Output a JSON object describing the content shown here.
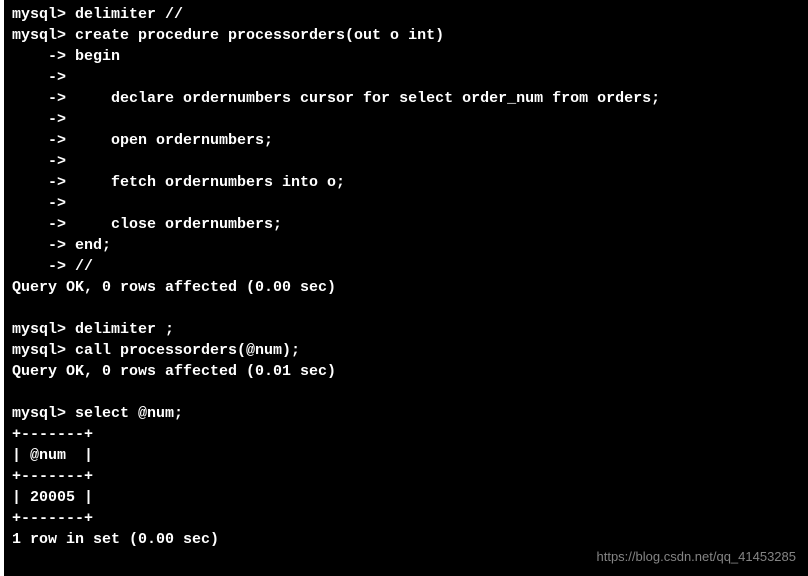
{
  "terminal": {
    "lines": [
      "mysql> delimiter //",
      "mysql> create procedure processorders(out o int)",
      "    -> begin",
      "    ->",
      "    ->     declare ordernumbers cursor for select order_num from orders;",
      "    ->",
      "    ->     open ordernumbers;",
      "    ->",
      "    ->     fetch ordernumbers into o;",
      "    ->",
      "    ->     close ordernumbers;",
      "    -> end;",
      "    -> //",
      "Query OK, 0 rows affected (0.00 sec)",
      "",
      "mysql> delimiter ;",
      "mysql> call processorders(@num);",
      "Query OK, 0 rows affected (0.01 sec)",
      "",
      "mysql> select @num;",
      "+-------+",
      "| @num  |",
      "+-------+",
      "| 20005 |",
      "+-------+",
      "1 row in set (0.00 sec)"
    ]
  },
  "watermark": "https://blog.csdn.net/qq_41453285"
}
